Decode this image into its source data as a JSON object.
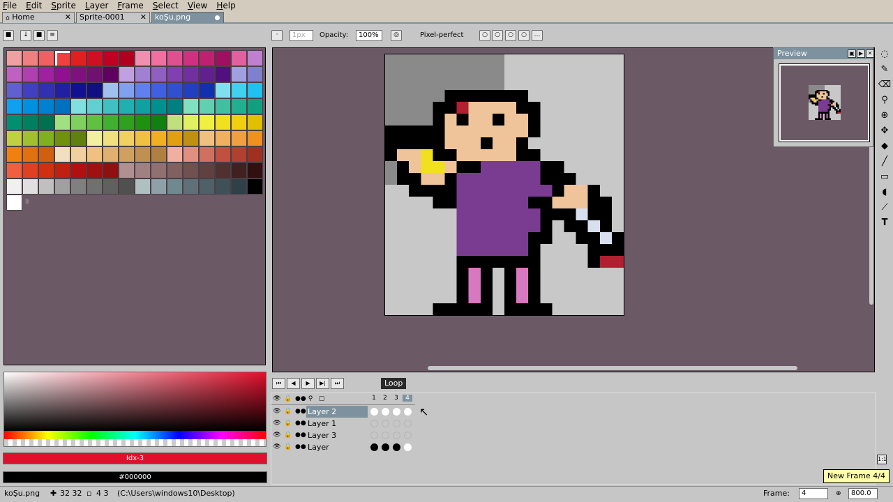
{
  "menu": [
    "File",
    "Edit",
    "Sprite",
    "Layer",
    "Frame",
    "Select",
    "View",
    "Help"
  ],
  "tabs": [
    {
      "label": "Home",
      "close": "✕"
    },
    {
      "label": "Sprite-0001",
      "close": "✕"
    },
    {
      "label": "koŞu.png"
    }
  ],
  "toolbar": {
    "brush_size": "1px",
    "opacity_label": "Opacity:",
    "opacity_value": "100%",
    "pixel_perfect_label": "Pixel-perfect"
  },
  "palette": {
    "colors": [
      "#f0a0a0",
      "#f08080",
      "#f06060",
      "#f04040",
      "#e02020",
      "#d01020",
      "#c00020",
      "#b00020",
      "#f090b0",
      "#f070a0",
      "#e05090",
      "#d03080",
      "#c02070",
      "#a01060",
      "#e060a0",
      "#c080d0",
      "#c060c0",
      "#b040b0",
      "#a020a0",
      "#901090",
      "#801080",
      "#701070",
      "#600060",
      "#c0a0e0",
      "#a080d0",
      "#9060c0",
      "#8040b0",
      "#7030a0",
      "#602090",
      "#501080",
      "#a0a0e0",
      "#8080d0",
      "#6060d0",
      "#4040c0",
      "#3030b0",
      "#2020a0",
      "#101090",
      "#101080",
      "#a0c0f0",
      "#80a0f0",
      "#6080f0",
      "#4060e0",
      "#3050d0",
      "#2040c0",
      "#1030b0",
      "#80e0f0",
      "#40d0f0",
      "#20c0f0",
      "#10a0f0",
      "#0090e0",
      "#0080d0",
      "#0070c0",
      "#80e0e0",
      "#60d0d0",
      "#40c0c0",
      "#20b0b0",
      "#10a0a0",
      "#009090",
      "#008080",
      "#80e0c0",
      "#60d0b0",
      "#40c0a0",
      "#20b090",
      "#10a080",
      "#009070",
      "#008060",
      "#007050",
      "#a0e080",
      "#80d060",
      "#60c040",
      "#40b030",
      "#30a020",
      "#209010",
      "#108010",
      "#c0e080",
      "#e0f060",
      "#f0f040",
      "#f0e020",
      "#f0d010",
      "#e0c000",
      "#c0d040",
      "#a0c030",
      "#80b020",
      "#709010",
      "#608010",
      "#f0f0a0",
      "#f0e080",
      "#f0d060",
      "#f0c040",
      "#f0b020",
      "#e0a010",
      "#c09010",
      "#f0c080",
      "#f0b060",
      "#f0a040",
      "#f09020",
      "#f08010",
      "#e07010",
      "#d06010",
      "#f0e0c0",
      "#f0d0a0",
      "#f0c080",
      "#e0b070",
      "#d0a060",
      "#c09050",
      "#b08040",
      "#f0b0a0",
      "#e09080",
      "#d07060",
      "#c05040",
      "#b04030",
      "#a03020",
      "#f06040",
      "#e04020",
      "#d03010",
      "#c02010",
      "#b01010",
      "#a01010",
      "#901010",
      "#b09090",
      "#a08080",
      "#907070",
      "#806060",
      "#705050",
      "#604040",
      "#503030",
      "#402020",
      "#301010",
      "#f0f0f0",
      "#e0e0e0",
      "#c0c0c0",
      "#a0a0a0",
      "#808080",
      "#707070",
      "#606060",
      "#505050",
      "#b0c0c0",
      "#90a0a8",
      "#708890",
      "#607078",
      "#506068",
      "#405058",
      "#304048",
      "#000000"
    ],
    "extra_mark": "II"
  },
  "fg_color": {
    "label": "Idx-3",
    "hex": "#e0102c"
  },
  "bg_color": {
    "label": "#000000",
    "hex": "#000000"
  },
  "preview": {
    "title": "Preview"
  },
  "timeline": {
    "loop_label": "Loop",
    "frames": [
      "1",
      "2",
      "3",
      "4"
    ],
    "layers": [
      {
        "name": "Layer 2",
        "selected": true,
        "cels": [
          "sel",
          "sel",
          "sel",
          "sel"
        ]
      },
      {
        "name": "Layer 1",
        "selected": false,
        "cels": [
          "dim",
          "dim",
          "dim",
          "dim"
        ]
      },
      {
        "name": "Layer 3",
        "selected": false,
        "cels": [
          "dim",
          "dim",
          "dim",
          "dim"
        ]
      },
      {
        "name": "Layer",
        "selected": false,
        "cels": [
          "full",
          "full",
          "full",
          "sel"
        ]
      }
    ]
  },
  "tooltip": {
    "text": "New Frame 4/4"
  },
  "status": {
    "filename": "koŞu.png",
    "coords": "32 32",
    "size": "4 3",
    "path": "(C:\\Users\\windows10\\Desktop)",
    "frame_label": "Frame:",
    "frame_value": "4",
    "zoom_value": "800.0"
  },
  "sprite": {
    "pixels": "20x22 grid",
    "colors": {
      "skin": "#efc49a",
      "shirt": "#7a3c90",
      "legs": "#d878c0",
      "hair_red": "#b02030",
      "outline": "#000000",
      "bg_dark": "#8a8a8a",
      "bg_light": "#c8c8c8",
      "yellow": "#f0e020",
      "blade": "#d8e0f0"
    }
  }
}
